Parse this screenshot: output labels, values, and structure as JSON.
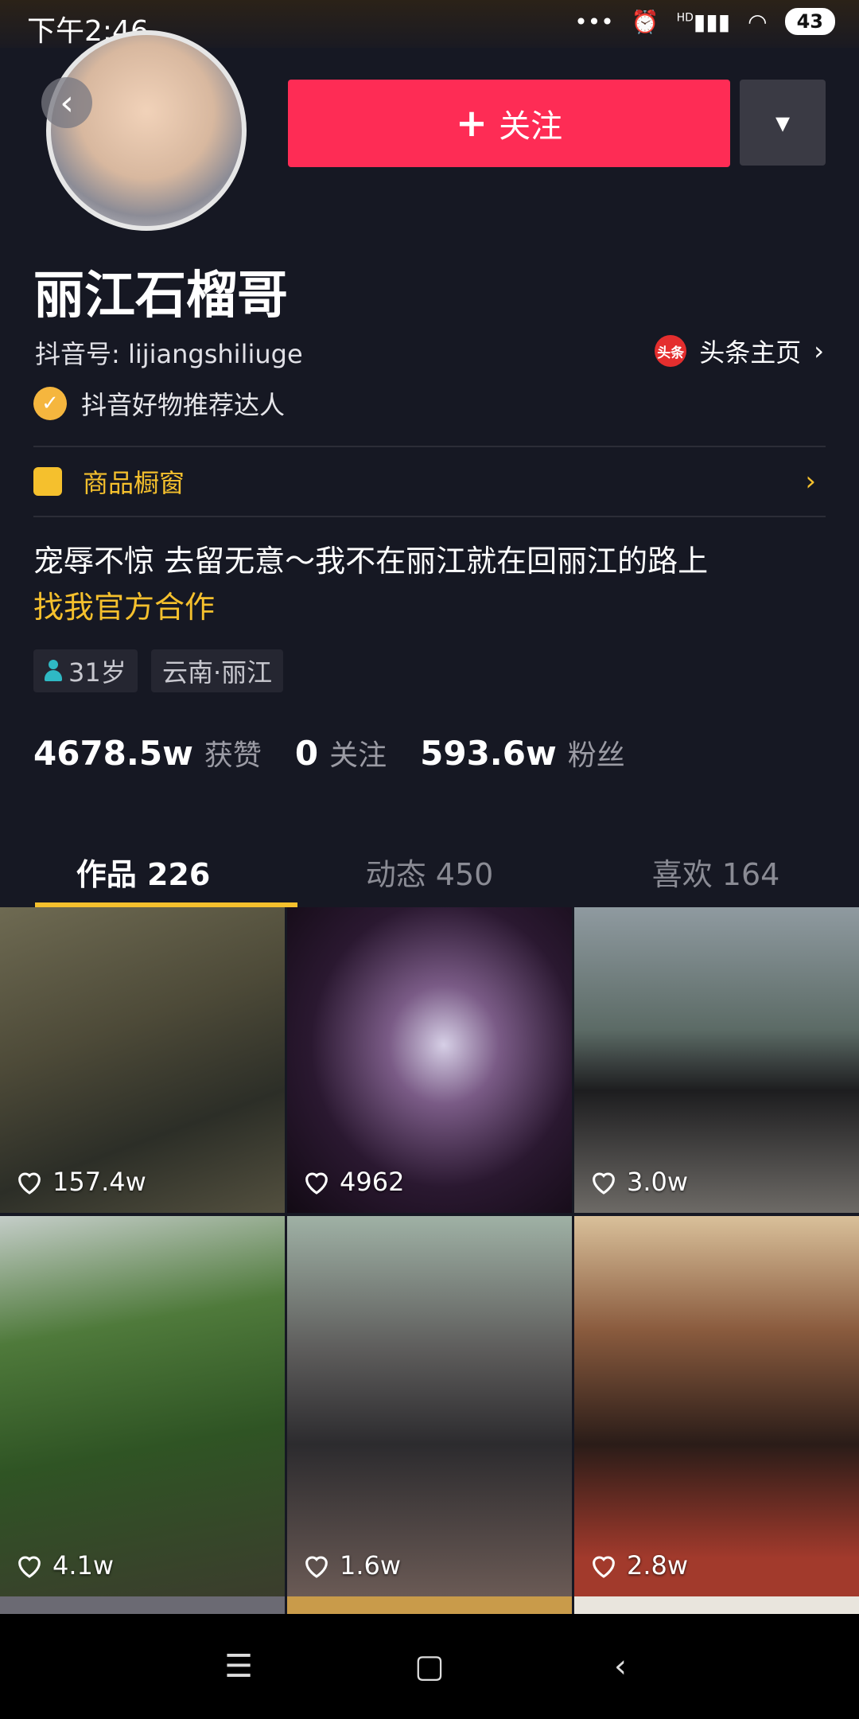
{
  "status_bar": {
    "time": "下午2:46",
    "icons": [
      "notification-dots",
      "alarm-icon",
      "signal-icon",
      "wifi-icon"
    ],
    "signal_label": "HD",
    "battery": "43"
  },
  "header": {
    "follow_label": "关注",
    "follow_icon": "+",
    "more_icon": "chevron-down-icon",
    "back_icon": "‹"
  },
  "profile": {
    "name": "丽江石榴哥",
    "douyin_id": "抖音号: lijiangshiliuge",
    "toutiao_icon_text": "头条",
    "toutiao_label": "头条主页",
    "verified_label": "抖音好物推荐达人",
    "shop_label": "商品橱窗",
    "bio": "宠辱不惊 去留无意～我不在丽江就在回丽江的路上",
    "bio_link": "找我官方合作",
    "tags": {
      "age": "31岁",
      "location": "云南·丽江"
    }
  },
  "stats": [
    {
      "value": "4678.5w",
      "label": "获赞"
    },
    {
      "value": "0",
      "label": "关注"
    },
    {
      "value": "593.6w",
      "label": "粉丝"
    }
  ],
  "tabs": [
    {
      "label": "作品 226",
      "active": true
    },
    {
      "label": "动态 450",
      "active": false
    },
    {
      "label": "喜欢 164",
      "active": false
    }
  ],
  "videos": [
    {
      "likes": "157.4w"
    },
    {
      "likes": "4962"
    },
    {
      "likes": "3.0w"
    },
    {
      "likes": "4.1w"
    },
    {
      "likes": "1.6w"
    },
    {
      "likes": "2.8w"
    }
  ],
  "colors": {
    "background": "#161823",
    "accent_red": "#fe2c55",
    "accent_yellow": "#f5c02d"
  },
  "nav": {
    "menu_icon": "☰",
    "home_icon": "▢",
    "back_icon": "‹"
  }
}
